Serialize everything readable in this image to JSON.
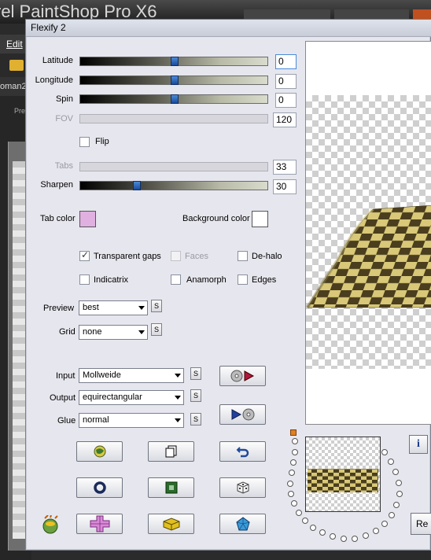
{
  "host": {
    "title": "rel PaintShop Pro X6",
    "menu_edit": "Edit",
    "tab_label": "oman2",
    "tab_label2": "Pre"
  },
  "dialog": {
    "title": "Flexify 2",
    "sliders": {
      "latitude": {
        "label": "Latitude",
        "value": "0",
        "position": 0.5
      },
      "longitude": {
        "label": "Longitude",
        "value": "0",
        "position": 0.5
      },
      "spin": {
        "label": "Spin",
        "value": "0",
        "position": 0.5
      },
      "fov": {
        "label": "FOV",
        "value": "120"
      },
      "tabs": {
        "label": "Tabs",
        "value": "33"
      },
      "sharpen": {
        "label": "Sharpen",
        "value": "30",
        "position": 0.3
      }
    },
    "flip_label": "Flip",
    "tab_color_label": "Tab color",
    "tab_color": "#e0b0e0",
    "background_color_label": "Background color",
    "background_color": "#ffffff",
    "options": {
      "transparent_gaps": "Transparent gaps",
      "faces": "Faces",
      "de_halo": "De-halo",
      "indicatrix": "Indicatrix",
      "anamorph": "Anamorph",
      "edges": "Edges"
    },
    "preview_label": "Preview",
    "preview_value": "best",
    "grid_label": "Grid",
    "grid_value": "none",
    "input_label": "Input",
    "input_value": "Mollweide",
    "output_label": "Output",
    "output_value": "equirectangular",
    "glue_label": "Glue",
    "glue_value": "normal",
    "s_label": "S",
    "info_label": "i",
    "reset_label": "Re"
  }
}
